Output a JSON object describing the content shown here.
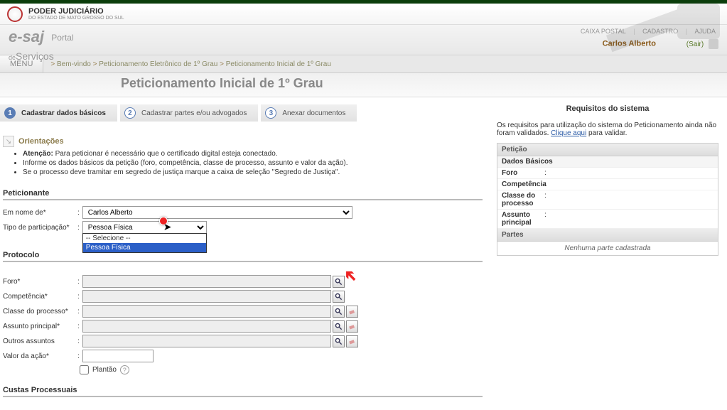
{
  "header": {
    "org": "PODER JUDICIÁRIO",
    "org_sub": "DO ESTADO DE MATO GROSSO DO SUL",
    "logo_main": "e-saj",
    "logo_portal": "Portal",
    "logo_de": "de",
    "logo_serv": "Serviços",
    "links": {
      "caixa": "CAIXA POSTAL",
      "cadastro": "CADASTRO",
      "ajuda": "AJUDA"
    },
    "user": "Carlos Alberto",
    "sair": "(Sair)"
  },
  "nav": {
    "menu": "MENU",
    "crumbs": [
      "Bem-vindo",
      "Peticionamento Eletrônico de 1º Grau",
      "Peticionamento Inicial de 1º Grau"
    ],
    "page_title": "Peticionamento Inicial de 1º Grau"
  },
  "steps": [
    {
      "n": "1",
      "label": "Cadastrar dados básicos"
    },
    {
      "n": "2",
      "label": "Cadastrar partes e/ou advogados"
    },
    {
      "n": "3",
      "label": "Anexar documentos"
    }
  ],
  "orient": {
    "title": "Orientações",
    "items": [
      {
        "bold": "Atenção:",
        "text": " Para peticionar é necessário que o certificado digital esteja conectado."
      },
      {
        "bold": "",
        "text": "Informe os dados básicos da petição (foro, competência, classe de processo, assunto e valor da ação)."
      },
      {
        "bold": "",
        "text": "Se o processo deve tramitar em segredo de justiça marque a caixa de seleção \"Segredo de Justiça\"."
      }
    ]
  },
  "sections": {
    "peticionante": "Peticionante",
    "protocolo": "Protocolo",
    "custas": "Custas Processuais"
  },
  "fields": {
    "em_nome": {
      "label": "Em nome de*",
      "value": "Carlos Alberto"
    },
    "tipo_part": {
      "label": "Tipo de participação*",
      "value": "Pessoa Física",
      "options": [
        "-- Selecione --",
        "Pessoa Física"
      ]
    },
    "foro": {
      "label": "Foro*"
    },
    "competencia": {
      "label": "Competência*"
    },
    "classe": {
      "label": "Classe do processo*"
    },
    "assunto": {
      "label": "Assunto principal*"
    },
    "outros": {
      "label": "Outros assuntos"
    },
    "valor": {
      "label": "Valor da ação*"
    },
    "plantao": {
      "label": "Plantão"
    }
  },
  "side": {
    "title": "Requisitos do sistema",
    "msg1": "Os requisitos para utilização do sistema do Peticionamento ainda não foram validados. ",
    "link": "Clique aqui",
    "msg2": " para validar.",
    "panel_peticao": "Petição",
    "panel_dados": "Dados Básicos",
    "rows": {
      "foro": "Foro",
      "competencia": "Competência",
      "classe": "Classe do processo",
      "assunto": "Assunto principal"
    },
    "panel_partes": "Partes",
    "partes_empty": "Nenhuma parte cadastrada"
  }
}
